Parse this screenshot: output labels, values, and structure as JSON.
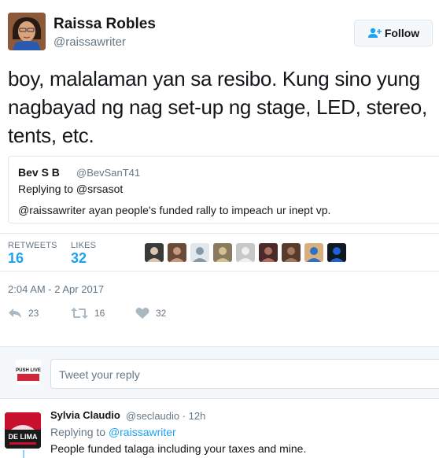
{
  "tweet": {
    "author_name": "Raissa Robles",
    "author_handle": "@raissawriter",
    "follow_label": "Follow",
    "text": "boy, malalaman yan sa resibo. Kung sino yung nagbayad ng nag set-up ng stage, LED, stereo, tents, etc.",
    "timestamp": "2:04 AM - 2 Apr 2017"
  },
  "quoted": {
    "author_name": "Bev S B",
    "author_handle": "@BevSanT41",
    "replying_to": "Replying to @srsasot",
    "text": "@raissawriter ayan people's funded rally to impeach ur inept vp."
  },
  "stats": {
    "retweets_label": "RETWEETS",
    "retweets_value": "16",
    "likes_label": "LIKES",
    "likes_value": "32"
  },
  "likers": [
    {
      "color": "#3a3a3a",
      "accent": "#d9c4b0"
    },
    {
      "color": "#6b4a3a",
      "accent": "#c49a80"
    },
    {
      "color": "#e1e8ed",
      "accent": "#8899a6"
    },
    {
      "color": "#8a7a60",
      "accent": "#d4c090"
    },
    {
      "color": "#c8c8c8",
      "accent": "#f0f0f0"
    },
    {
      "color": "#4a2a2a",
      "accent": "#b07060"
    },
    {
      "color": "#5a3a2a",
      "accent": "#a07a60"
    },
    {
      "color": "#d8b080",
      "accent": "#3070c0"
    },
    {
      "color": "#101820",
      "accent": "#2060d0"
    }
  ],
  "actions": {
    "reply_count": "23",
    "retweet_count": "16",
    "like_count": "32"
  },
  "reply_box": {
    "placeholder": "Tweet your reply",
    "avatar_text": "PUSH LIVE"
  },
  "comment": {
    "author_name": "Sylvia Claudio",
    "meta": "@seclaudio · 12h",
    "replying_prefix": "Replying to",
    "replying_handle": "@raissawriter",
    "text": "People funded talaga including your taxes and mine.",
    "avatar_text": "DE LIMA"
  },
  "colors": {
    "accent": "#1da1f2",
    "muted": "#657786",
    "border": "#e1e8ed",
    "icon_gray": "#aab8c2"
  }
}
